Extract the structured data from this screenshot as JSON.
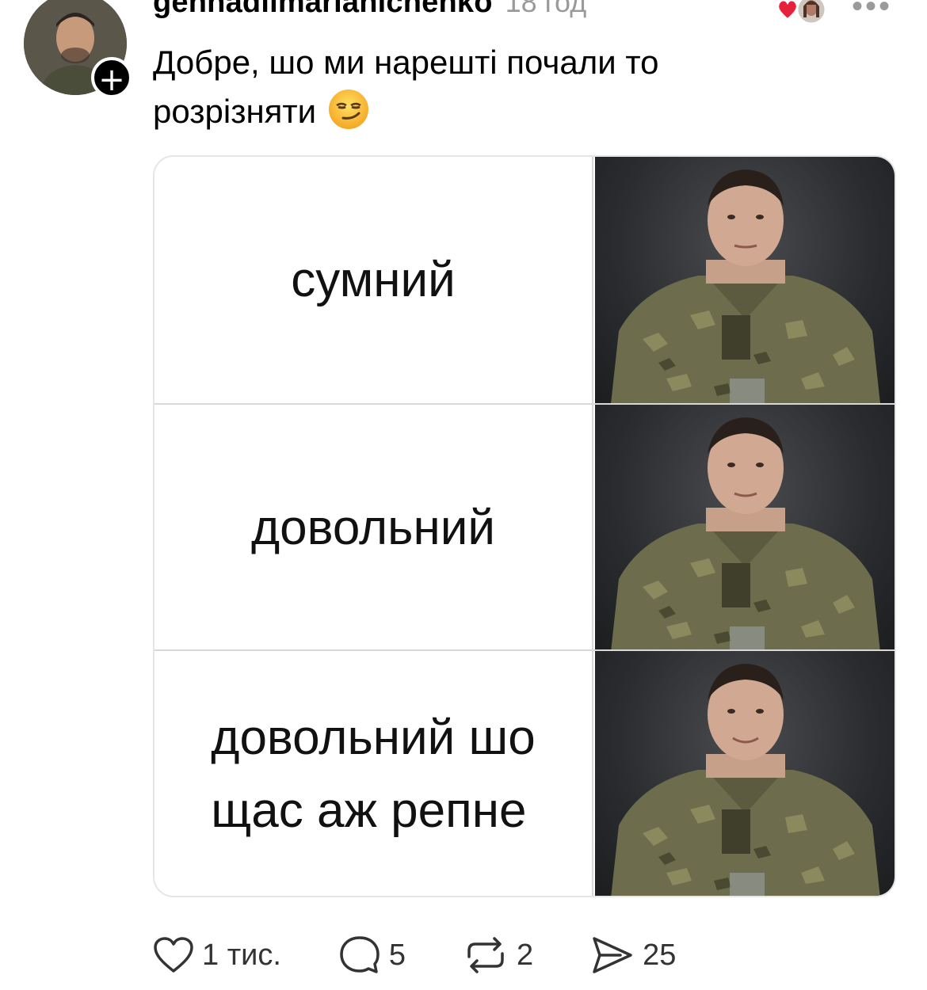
{
  "post": {
    "username": "gennadiimarianichenko",
    "timestamp": "18 год",
    "text_line1": "Добре, шо ми нарешті почали то",
    "text_line2": "розрізняти"
  },
  "meme": {
    "panels": [
      {
        "caption": "сумний"
      },
      {
        "caption": "довольний"
      },
      {
        "caption": "довольний шо\nщас аж репне"
      }
    ]
  },
  "actions": {
    "likes": "1 тис.",
    "comments": "5",
    "reposts": "2",
    "shares": "25"
  },
  "colors": {
    "like_heart": "#e8213a",
    "meta_gray": "#9a9a9a",
    "camo_base": "#6d6c4c"
  },
  "icons": {
    "avatar_badge": "plus-icon",
    "liked_indicator": "heart-icon",
    "menu": "more-icon",
    "emoji": "smirking-face-emoji"
  }
}
